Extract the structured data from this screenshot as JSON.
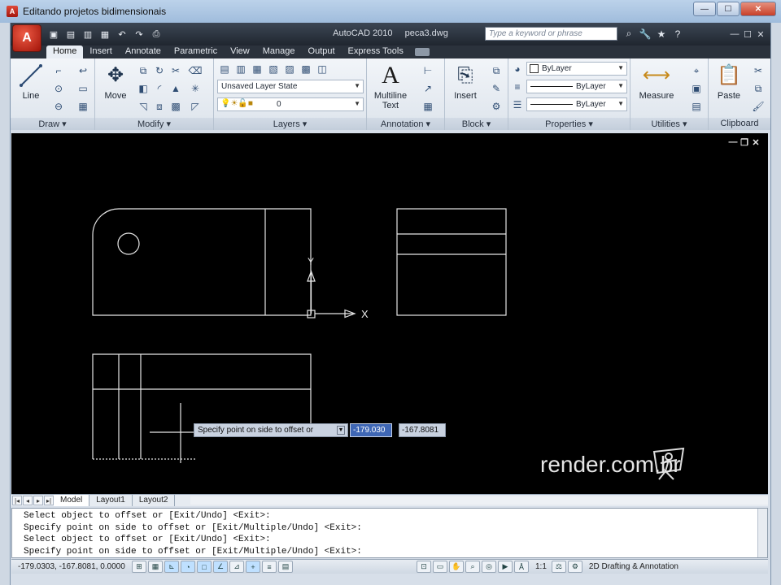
{
  "window": {
    "title": "Editando projetos bidimensionais",
    "controls": {
      "minimize": "—",
      "maximize": "☐",
      "close": "✕"
    }
  },
  "acad": {
    "app_name": "AutoCAD 2010",
    "file_name": "peca3.dwg",
    "app_button": "A",
    "search_placeholder": "Type a keyword or phrase",
    "qat": [
      "▣",
      "▤",
      "▥",
      "▦",
      "↶",
      "↷",
      "⎙"
    ],
    "info_tools": [
      "⌕",
      "🔧",
      "★",
      "?"
    ],
    "controls": [
      "—",
      "☐",
      "✕"
    ]
  },
  "ribbon": {
    "tabs": [
      "Home",
      "Insert",
      "Annotate",
      "Parametric",
      "View",
      "Manage",
      "Output",
      "Express Tools"
    ],
    "active_tab": "Home",
    "panels": {
      "draw": {
        "label": "Draw ▾",
        "line": "Line"
      },
      "modify": {
        "label": "Modify ▾",
        "move": "Move"
      },
      "layers": {
        "label": "Layers ▾",
        "layer_state": "Unsaved Layer State",
        "current_layer": "0"
      },
      "annotation": {
        "label": "Annotation ▾",
        "text_l1": "Multiline",
        "text_l2": "Text"
      },
      "block": {
        "label": "Block ▾",
        "insert": "Insert"
      },
      "properties": {
        "label": "Properties ▾",
        "color": "ByLayer",
        "linetype": "ByLayer",
        "lineweight": "ByLayer"
      },
      "utilities": {
        "label": "Utilities ▾",
        "measure": "Measure"
      },
      "clipboard": {
        "label": "Clipboard",
        "paste": "Paste"
      }
    }
  },
  "drawing": {
    "background": "#000000",
    "line_color": "#e6e6e6",
    "ucs_x": "X",
    "ucs_y": "Y",
    "dynamic_prompt": "Specify point on side to offset or",
    "input_x": "-179.030",
    "input_y": "-167.8081",
    "watermark": "render.com.br",
    "viewport_controls": [
      "—",
      "❐",
      "✕"
    ]
  },
  "layout_tabs": {
    "nav": [
      "|◂",
      "◂",
      "▸",
      "▸|"
    ],
    "tabs": [
      "Model",
      "Layout1",
      "Layout2"
    ],
    "active": "Model"
  },
  "command_line": {
    "lines": [
      "Select object to offset or [Exit/Undo] <Exit>:",
      "Specify point on side to offset or [Exit/Multiple/Undo] <Exit>:",
      "Select object to offset or [Exit/Undo] <Exit>:",
      "Specify point on side to offset or [Exit/Multiple/Undo] <Exit>:"
    ]
  },
  "status_bar": {
    "coordinates": "-179.0303, -167.8081, 0.0000",
    "scale": "1:1",
    "workspace": "2D Drafting & Annotation"
  }
}
